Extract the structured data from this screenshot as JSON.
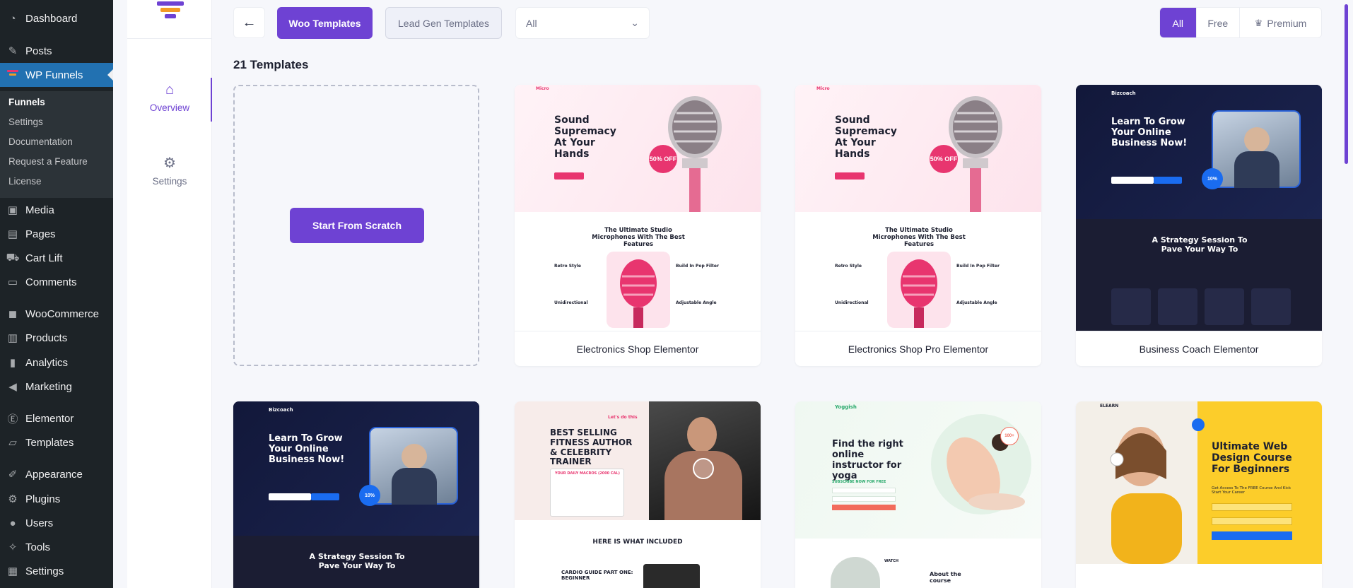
{
  "sidebar": {
    "items": [
      {
        "label": "Dashboard",
        "icon": "dashboard-icon"
      },
      {
        "label": "Posts",
        "icon": "pin-icon"
      },
      {
        "label": "WP Funnels",
        "icon": "funnel-icon"
      },
      {
        "label": "Media",
        "icon": "media-icon"
      },
      {
        "label": "Pages",
        "icon": "pages-icon"
      },
      {
        "label": "Cart Lift",
        "icon": "cart-icon"
      },
      {
        "label": "Comments",
        "icon": "comment-icon"
      },
      {
        "label": "WooCommerce",
        "icon": "woo-icon"
      },
      {
        "label": "Products",
        "icon": "archive-icon"
      },
      {
        "label": "Analytics",
        "icon": "bar-chart-icon"
      },
      {
        "label": "Marketing",
        "icon": "megaphone-icon"
      },
      {
        "label": "Elementor",
        "icon": "elementor-icon"
      },
      {
        "label": "Templates",
        "icon": "folder-icon"
      },
      {
        "label": "Appearance",
        "icon": "brush-icon"
      },
      {
        "label": "Plugins",
        "icon": "plugin-icon"
      },
      {
        "label": "Users",
        "icon": "user-icon"
      },
      {
        "label": "Tools",
        "icon": "wrench-icon"
      },
      {
        "label": "Settings",
        "icon": "settings-icon"
      }
    ],
    "submenu": [
      "Funnels",
      "Settings",
      "Documentation",
      "Request a Feature",
      "License"
    ]
  },
  "plugin_nav": {
    "overview": "Overview",
    "settings": "Settings"
  },
  "toolbar": {
    "back_icon": "arrow-left-icon",
    "woo_label": "Woo Templates",
    "lead_label": "Lead Gen Templates",
    "filter_value": "All",
    "plans": {
      "all": "All",
      "free": "Free",
      "premium": "Premium"
    }
  },
  "count_label": "21 Templates",
  "scratch_label": "Start From Scratch",
  "templates": [
    {
      "name": "Electronics Shop Elementor"
    },
    {
      "name": "Electronics Shop Pro Elementor"
    },
    {
      "name": "Business Coach Elementor"
    }
  ],
  "thumbs": {
    "mic_brand": "Micro",
    "mic_heading": "Sound Supremacy At Your Hands",
    "mic_badge": "50% OFF",
    "mic_features_title": "The Ultimate Studio Microphones With The Best Features",
    "mic_f1": "Retro Style",
    "mic_f2": "Build In Pop Filter",
    "mic_f3": "Unidirectional",
    "mic_f4": "Adjustable Angle",
    "coach_brand": "Bizcoach",
    "coach_heading": "Learn To Grow Your Online Business Now!",
    "coach_sub": "A Strategy Session To Pave Your Way To",
    "coach_badge": "10%",
    "fit_brand": "Let's do this",
    "fit_heading": "BEST SELLING FITNESS AUTHOR & CELEBRITY TRAINER",
    "fit_box": "YOUR DAILY MACROS (2000 CAL)",
    "fit_included": "HERE IS WHAT INCLUDED",
    "fit_cardio": "CARDIO GUIDE PART ONE: BEGINNER",
    "yoga_brand": "Yoggish",
    "yoga_heading": "Find the right online instructor for yoga",
    "yoga_sub": "SUBSCRIBE NOW FOR FREE",
    "yoga_badge": "100+",
    "yoga_about": "About the course",
    "yoga_watch": "WATCH",
    "learn_brand": "ELEARN",
    "learn_heading": "Ultimate Web Design Course For Beginners",
    "learn_sub": "Get Access To The FREE Course And Kick Start Your Career"
  },
  "colors": {
    "wp_sidebar": "#1d2327",
    "wp_active": "#2271b1",
    "accent": "#6e42d3",
    "mic_pink": "#e8356f",
    "coach_blue": "#1a6cf0",
    "yoga_green": "#27a86a",
    "learn_yellow": "#fccd2a"
  }
}
